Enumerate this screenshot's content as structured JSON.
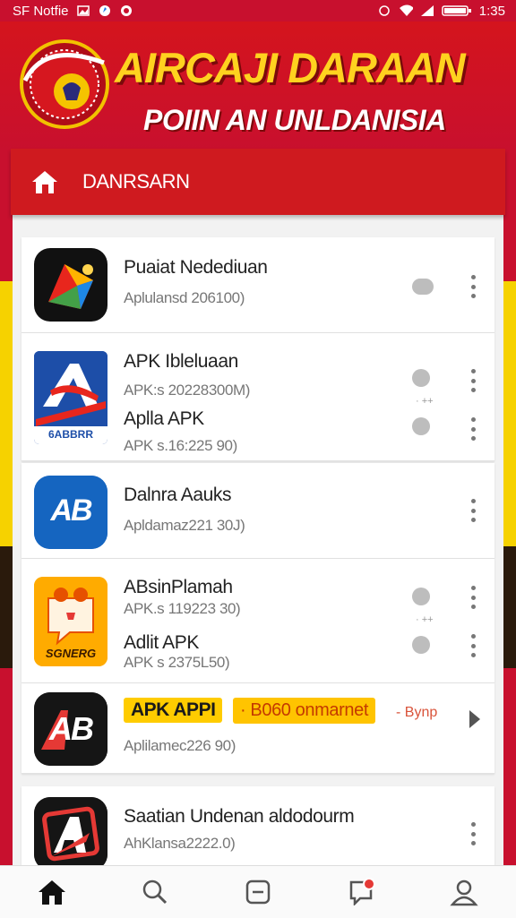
{
  "status_bar": {
    "left_text": "SF Notfie",
    "time": "1:35"
  },
  "header": {
    "title_line1": "AIRCAJI DARAAN",
    "title_line2": "POIIN AN UNLDANISIA"
  },
  "breadcrumb": {
    "label": "DANRSARN"
  },
  "apps": [
    {
      "title": "Puaiat Nedediuan",
      "subtitle": "Aplulansd 206100)"
    },
    {
      "title": "APK Ibleluaan",
      "subtitle": "APK:s 20228300M)"
    },
    {
      "title": "Aplla APK",
      "subtitle": "APK s.16:225 90)"
    },
    {
      "title": "Dalnra Aauks",
      "subtitle": "Apldamaz221 30J)"
    },
    {
      "title": "ABsinPlamah",
      "subtitle": "APK.s 119223 30)"
    },
    {
      "title": "Adlit APK",
      "subtitle": "APK s 2375L50)"
    },
    {
      "title": "Aplilamec226 90)",
      "subtitle": ""
    },
    {
      "title": "Saatian Undenan aldodourm",
      "subtitle": "AhKlansa2222.0)"
    }
  ],
  "promo": {
    "badge_apk": "APK APPI",
    "badge_offer": "· B060 onmarnet",
    "sync_text": "- Bynp"
  },
  "icon_labels": {
    "apk_icon_text": "6ABBRR",
    "ab_icon_text": "AB",
    "orange_icon_text": "SGNERG",
    "black_ab_text": "AB"
  },
  "colors": {
    "primary_red": "#c8102e",
    "accent_yellow": "#ffd21f"
  }
}
